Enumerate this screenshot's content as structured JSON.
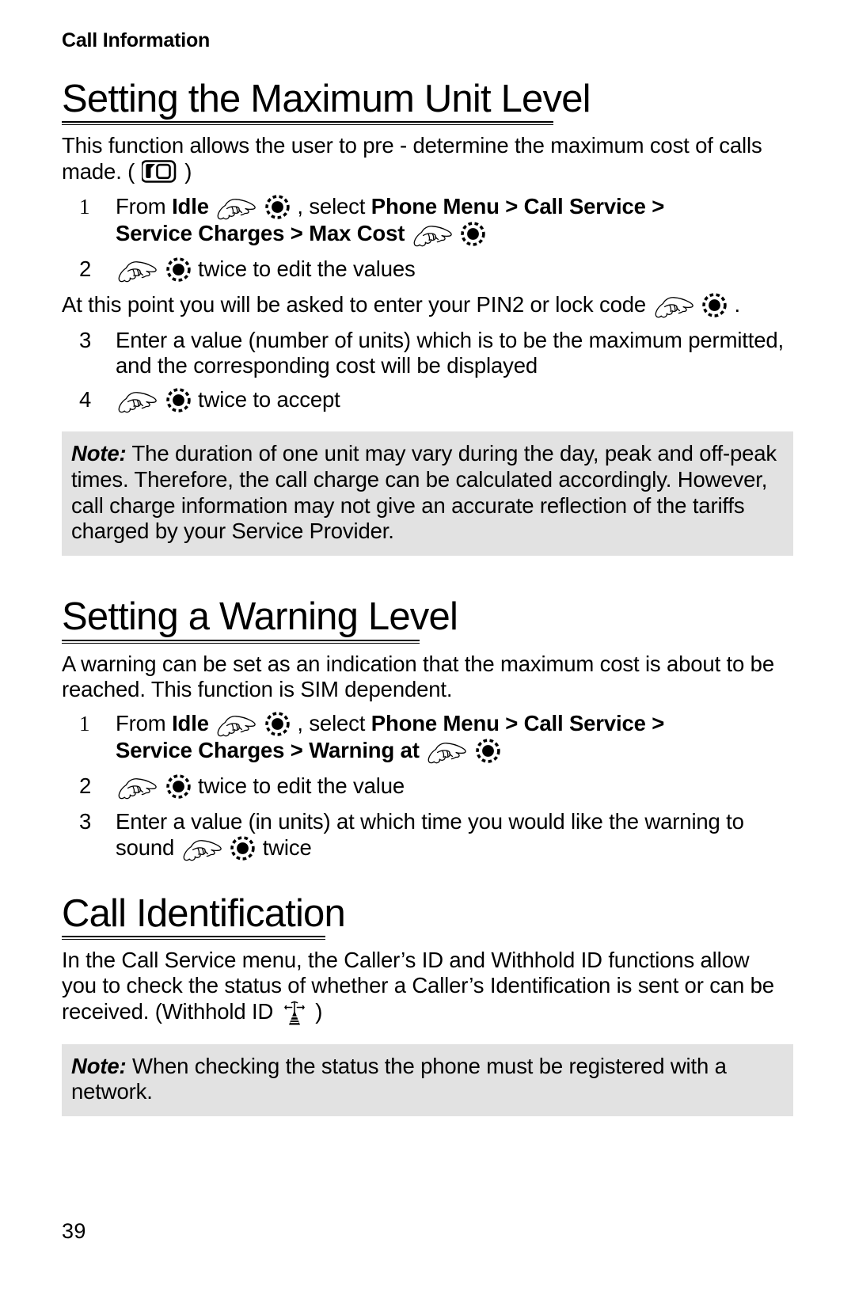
{
  "document": {
    "running_head": "Call Information",
    "page_number": "39"
  },
  "sections": [
    {
      "heading": "Setting the Maximum Unit Level",
      "intro_before_sim": "This function allows the user to pre - determine the maximum cost of calls made. (",
      "intro_after_sim": ")",
      "steps": [
        {
          "number": "1",
          "line1_prefix": "From ",
          "line1_bold1": "Idle",
          "line1_mid": ", select ",
          "line1_bold2": "Phone Menu",
          "line1_sep1": " > ",
          "line1_bold3": "Call Service",
          "line1_sep2": " >",
          "line2_bold1": "Service Charges",
          "line2_sep": " > ",
          "line2_bold2": "Max Cost"
        },
        {
          "number": "2",
          "text": "twice to edit the values"
        },
        {
          "number": "3",
          "text": "Enter a value (number of units) which is to be the maximum permitted, and the corresponding cost will be displayed"
        },
        {
          "number": "4",
          "text": "twice to accept"
        }
      ],
      "interstitial": "At this point you will be asked to enter your PIN2 or lock code",
      "interstitial_tail": ".",
      "note_label": "Note:",
      "note_text": " The duration of one unit may vary during the day, peak and off-peak times. Therefore, the call charge can be calculated accordingly. However, call charge information may not give an accurate reflection of the tariffs charged by your Service Provider."
    },
    {
      "heading": "Setting a Warning Level",
      "intro": "A warning can be set as an indication that the maximum cost is about to be reached. This function is SIM dependent.",
      "steps": [
        {
          "number": "1",
          "line1_prefix": "From ",
          "line1_bold1": "Idle",
          "line1_mid": ", select ",
          "line1_bold2": "Phone Menu",
          "line1_sep1": " > ",
          "line1_bold3": "Call Service",
          "line1_sep2": " >",
          "line2_bold1": "Service Charges",
          "line2_sep": " > ",
          "line2_bold2": "Warning at"
        },
        {
          "number": "2",
          "text": "twice to edit the value"
        },
        {
          "number": "3",
          "text_line1": "Enter a value (in units) at which time you would like the warning to",
          "text_line2_prefix": "sound",
          "text_line2_suffix": "twice"
        }
      ]
    },
    {
      "heading": "Call Identification",
      "intro_line1": "In the Call Service menu, the Caller’s ID and Withhold ID functions allow",
      "intro_line2": "you to check the status of whether a Caller’s Identification is sent or can be",
      "intro_line3_prefix": "received. (Withhold ID",
      "intro_line3_suffix": ")",
      "note_label": "Note:",
      "note_text": " When checking the status the phone must be registered with a network."
    }
  ],
  "icons": {
    "hand": "pointing-hand-icon",
    "select_key": "select-key-icon",
    "sim_card": "sim-card-icon",
    "antenna": "antenna-mast-icon"
  },
  "colors": {
    "text": "#000000",
    "page_background": "#ffffff",
    "note_background": "#e2e2e2",
    "rule": "#000000"
  }
}
